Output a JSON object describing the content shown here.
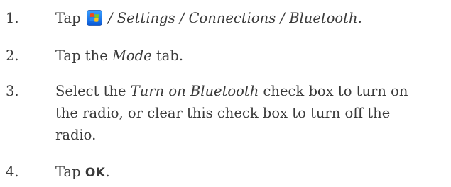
{
  "steps": [
    {
      "number": "1.",
      "prefix": "Tap",
      "icon": "windows-start-icon",
      "path": " / Settings / Connections / Bluetooth."
    },
    {
      "number": "2.",
      "prefix": "Tap the ",
      "emphasis": "Mode",
      "suffix": " tab."
    },
    {
      "number": "3.",
      "prefix": "Select the ",
      "emphasis": "Turn on Bluetooth",
      "line1_suffix": " check box to turn on",
      "line2": "the radio, or clear this check box to turn off the",
      "line3": "radio."
    },
    {
      "number": "4.",
      "prefix": "Tap ",
      "ui_label": "OK",
      "suffix": "."
    }
  ]
}
